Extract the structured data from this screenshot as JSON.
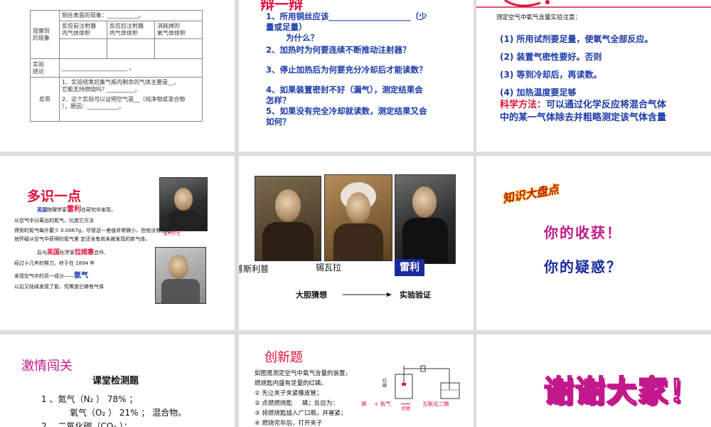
{
  "slide1": {
    "obs_label": "观察到\n的现象",
    "copper_label": "铜丝表面的现象：___________。",
    "col1": "反应前注射器\n内气体体积",
    "col2": "反应后注射器\n内气体体积",
    "col3": "消耗掉的\n氧气体体积",
    "conc_label": "实验\n结论",
    "conc_blank": "_______________________ 。",
    "reflect_label": "反思",
    "reflect1": "1．实验结束后集气瓶内剩余的气体主要是__，\n它能支持燃烧吗? __________。",
    "reflect2": "2．这个实验可以证明空气是__（纯净物或混合物\n），原因：___________。"
  },
  "slide2": {
    "title": "辩一辩",
    "q1a": "1、所用铜丝应该____________________（少",
    "q1b": "量或足量）",
    "q1c": "为什么？",
    "q2": "2、加热时为何要连续不断推动注射器？",
    "q3": "3、停止加热后为何要充分冷却后才能读数？",
    "q4a": "4、如果装置密封不好（漏气），测定结果会",
    "q4b": "怎样？",
    "q5a": "5、如果没有完全冷却就读数，测定结果又会",
    "q5b": "如何？"
  },
  "slide3": {
    "subtitle": "测定空气中氧气含量实验注意：",
    "p1": "(1) 所用试剂要足量，使氧气全部反应。",
    "p2": "(2) 装置气密性要好。否则",
    "p3": "(3) 等到冷却后，再读数。",
    "p4": "(4) 加热温度要足够",
    "method_label": "科学方法：",
    "method_text": "可以通过化学反应将混合气体",
    "method_text2": "中的某一气体除去并粗略测定该气体含量"
  },
  "slide4": {
    "title": "多识一点",
    "l1a": "英国",
    "l1b": "物理学家",
    "l1c": "雷利",
    "l1d": "在研究中发现，",
    "l2": "从空气中分离出的氮气，比其它方法",
    "l3": "得到的氮气每升要少 0.0067g，尽管这一差值非常微小，但他没有放过。",
    "l4": "他怀疑从空气中获得的氮气里    定还含有尚未被发现的新气体。",
    "l5a": "后与",
    "l5b": "英国",
    "l5c": "化学家",
    "l5d": "拉姆塞",
    "l5e": "合作,",
    "l6": "经过十几年的努力，终于在 1894 年",
    "l7a": "发现空气中的另一成分——",
    "l7b": "氩气",
    "l8": "以后又陆续发现了氦、氖等其它稀有气体",
    "caption": "雷利先生"
  },
  "slide5": {
    "name1": "普斯利普",
    "name2": "锡瓦拉",
    "name3": "雷利",
    "guess": "大胆猜想",
    "verify": "实验验证"
  },
  "slide6": {
    "banner": "知识大盘点",
    "gain": "你的收获！",
    "doubt": "你的疑惑？"
  },
  "slide7": {
    "title": "激情闯关",
    "subtitle": "课堂检测题",
    "l1": "1 、氮气（N₂ ）     78% ；",
    "l2": "氧气（O₂ ）     21% ；   混合物。",
    "l3": "2 、二氧化碳（CO₂ ）；"
  },
  "slide8": {
    "title": "创新题",
    "l1": "如图是测定空气中氧气含量的装置，",
    "l2": "燃烧匙内盛有足量的红磷。",
    "l3": "① 先让夹子夹紧橡皮管；",
    "l4a": "② 点燃燃烧匙",
    "l4b": "磷；反应为：",
    "l5": "③ 将燃烧匙插入广口瓶，并塞紧；",
    "l6": "④ 燃烧完毕后，打开夹子",
    "eq_p": "磷",
    "eq_plus": "+ 氧气",
    "eq_cond": "点燃",
    "eq_product": "五氧化二磷",
    "label_p": "红磷"
  },
  "slide9": {
    "thanks": "谢谢大家！"
  },
  "colors": {
    "blue": "#1a3aa8",
    "red": "#e0103a",
    "magenta": "#c2188c",
    "bg": "#dcdcdc"
  }
}
